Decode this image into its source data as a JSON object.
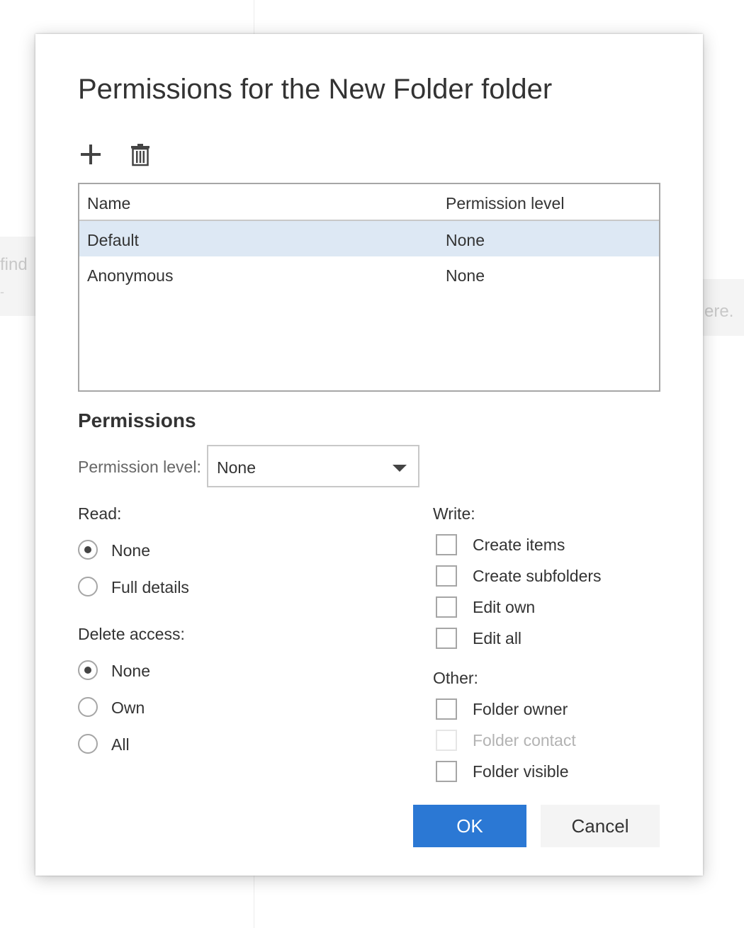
{
  "background": {
    "left_hint": "find",
    "left_hint2": "-",
    "right_hint": "ere."
  },
  "dialog": {
    "title": "Permissions for the New Folder folder",
    "toolbar": {
      "add_icon": "plus-icon",
      "delete_icon": "trash-icon"
    },
    "table": {
      "columns": [
        "Name",
        "Permission level"
      ],
      "rows": [
        {
          "name": "Default",
          "level": "None",
          "selected": true
        },
        {
          "name": "Anonymous",
          "level": "None",
          "selected": false
        }
      ]
    },
    "permissions": {
      "heading": "Permissions",
      "level_label": "Permission level:",
      "level_value": "None",
      "read": {
        "label": "Read:",
        "options": [
          "None",
          "Full details"
        ],
        "selected": "None"
      },
      "delete": {
        "label": "Delete access:",
        "options": [
          "None",
          "Own",
          "All"
        ],
        "selected": "None"
      },
      "write": {
        "label": "Write:",
        "options": [
          "Create items",
          "Create subfolders",
          "Edit own",
          "Edit all"
        ]
      },
      "other": {
        "label": "Other:",
        "options": [
          "Folder owner",
          "Folder contact",
          "Folder visible"
        ],
        "disabled": [
          "Folder contact"
        ]
      }
    },
    "buttons": {
      "ok": "OK",
      "cancel": "Cancel"
    },
    "colors": {
      "primary": "#2b78d4",
      "selected_row": "#dde8f4"
    }
  }
}
